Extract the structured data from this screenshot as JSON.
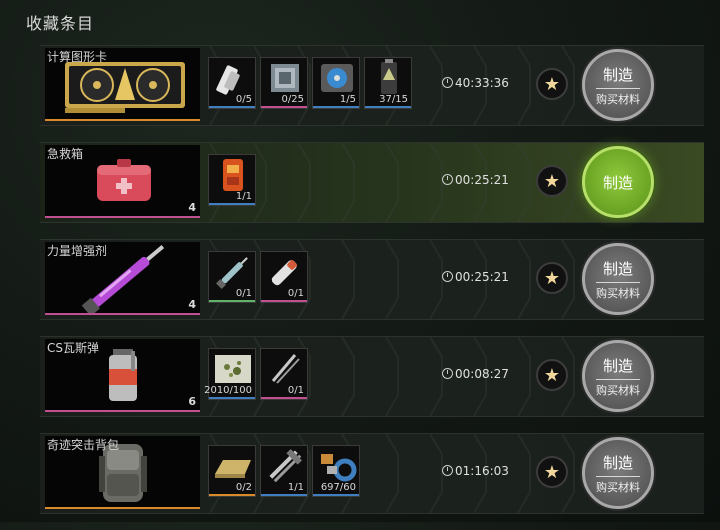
{
  "page_title": "收藏条目",
  "colors": {
    "orange": "#d98a2b",
    "pink": "#c0508f",
    "green": "#5fb36a",
    "blue": "#3f7fc0",
    "purple": "#a34fc0",
    "grey": "#8a8a8a"
  },
  "rows": [
    {
      "name": "计算图形卡",
      "count": "",
      "underline": "#d98a2b",
      "timer": "40:33:36",
      "craft_label": "制造",
      "buy_label": "购买材料",
      "ready": false,
      "materials": [
        {
          "qty": "0/5",
          "bar": "#3f7fc0",
          "icon": "bandage-icon"
        },
        {
          "qty": "0/25",
          "bar": "#c0508f",
          "icon": "cpu-icon"
        },
        {
          "qty": "1/5",
          "bar": "#3f7fc0",
          "icon": "cooler-fan-icon"
        },
        {
          "qty": "37/15",
          "bar": "#3f7fc0",
          "icon": "battery-icon"
        }
      ]
    },
    {
      "name": "急救箱",
      "count": "4",
      "underline": "#c0508f",
      "timer": "00:25:21",
      "craft_label": "制造",
      "buy_label": "",
      "ready": true,
      "materials": [
        {
          "qty": "1/1",
          "bar": "#3f7fc0",
          "icon": "medkit-pouch-icon"
        }
      ]
    },
    {
      "name": "力量增强剂",
      "count": "4",
      "underline": "#c0508f",
      "timer": "00:25:21",
      "craft_label": "制造",
      "buy_label": "购买材料",
      "ready": false,
      "materials": [
        {
          "qty": "0/1",
          "bar": "#5fb36a",
          "icon": "syringe-icon"
        },
        {
          "qty": "0/1",
          "bar": "#c0508f",
          "icon": "injector-icon"
        }
      ]
    },
    {
      "name": "CS瓦斯弹",
      "count": "6",
      "underline": "#c0508f",
      "timer": "00:08:27",
      "craft_label": "制造",
      "buy_label": "购买材料",
      "ready": false,
      "materials": [
        {
          "qty": "2010/100",
          "bar": "#3f7fc0",
          "icon": "powder-icon"
        },
        {
          "qty": "0/1",
          "bar": "#c0508f",
          "icon": "wire-icon"
        }
      ]
    },
    {
      "name": "奇迹突击背包",
      "count": "",
      "underline": "#d98a2b",
      "timer": "01:16:03",
      "craft_label": "制造",
      "buy_label": "购买材料",
      "ready": false,
      "materials": [
        {
          "qty": "0/2",
          "bar": "#d98a2b",
          "icon": "gold-bar-icon"
        },
        {
          "qty": "1/1",
          "bar": "#3f7fc0",
          "icon": "multitool-icon"
        },
        {
          "qty": "697/60",
          "bar": "#3f7fc0",
          "icon": "tape-parts-icon"
        }
      ]
    }
  ]
}
